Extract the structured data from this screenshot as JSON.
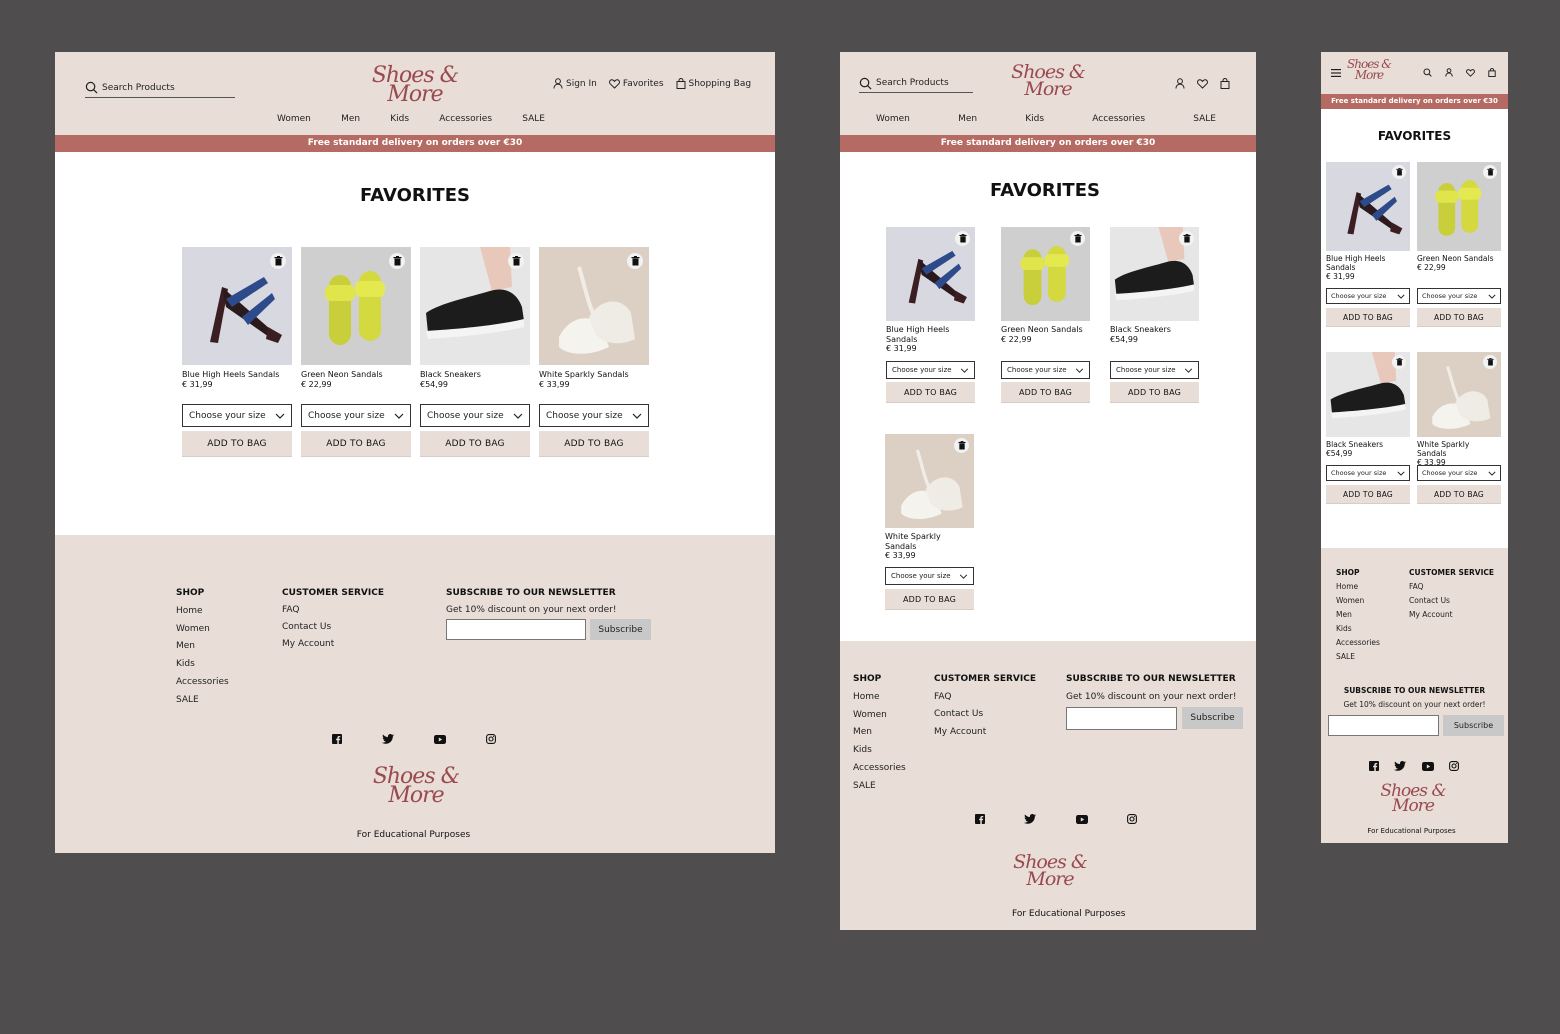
{
  "brand": {
    "line1": "Shoes &",
    "line2": "More"
  },
  "search": {
    "placeholder": "Search Products"
  },
  "account": {
    "sign_in": "Sign In",
    "favorites": "Favorites",
    "bag": "Shopping Bag"
  },
  "nav": [
    "Women",
    "Men",
    "Kids",
    "Accessories",
    "SALE"
  ],
  "banner": "Free standard delivery on orders over €30",
  "page_title": "FAVORITES",
  "size_placeholder": "Choose your size",
  "add_to_bag": "ADD TO BAG",
  "products": [
    {
      "name": "Blue High Heels Sandals",
      "price": "€ 31,99",
      "image": "blue-high-heel-sandal"
    },
    {
      "name": "Green Neon Sandals",
      "price": "€ 22,99",
      "image": "neon-yellow-slide-sandals"
    },
    {
      "name": "Black Sneakers",
      "price": "€54,99",
      "image": "black-sneaker"
    },
    {
      "name": "White Sparkly Sandals",
      "price": "€ 33,99",
      "image": "white-sparkly-flats"
    }
  ],
  "footer": {
    "shop_title": "SHOP",
    "shop_links": [
      "Home",
      "Women",
      "Men",
      "Kids",
      "Accessories",
      "SALE"
    ],
    "service_title": "CUSTOMER SERVICE",
    "service_links": [
      "FAQ",
      "Contact Us",
      "My Account"
    ],
    "newsletter_title": "SUBSCRIBE TO OUR NEWSLETTER",
    "newsletter_text": "Get 10% discount on your next order!",
    "subscribe": "Subscribe",
    "social": [
      "facebook-icon",
      "twitter-icon",
      "youtube-icon",
      "instagram-icon"
    ],
    "edu": "For Educational Purposes"
  },
  "colors": {
    "beige": "#e8ddd7",
    "banner": "#b56b63",
    "brand": "#9a4a4f",
    "canvas": "#4f4d4e"
  }
}
